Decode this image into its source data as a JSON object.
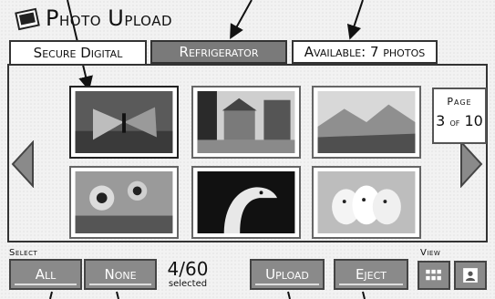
{
  "app": {
    "title_first": "P",
    "title_rest": "hoto",
    "title_first2": "U",
    "title_rest2": "pload"
  },
  "tabs": [
    {
      "label": "Secure Digital"
    },
    {
      "label": "Refrigerator"
    },
    {
      "label": "Available: 7 photos"
    }
  ],
  "photos": [
    {
      "icon": "butterfly-photo"
    },
    {
      "icon": "street-houses-photo"
    },
    {
      "icon": "mountain-landscape-photo"
    },
    {
      "icon": "sunflowers-photo"
    },
    {
      "icon": "bird-photo"
    },
    {
      "icon": "puppies-photo"
    }
  ],
  "page": {
    "label": "Page",
    "current": "3",
    "of": "of",
    "total": "10"
  },
  "select": {
    "label": "Select",
    "all": "All",
    "none": "None"
  },
  "counter": {
    "value": "4/60",
    "sub": "selected"
  },
  "actions": {
    "upload": "Upload",
    "eject": "Eject"
  },
  "view": {
    "label": "View"
  },
  "colors": {
    "tab_active_bg": "#7a7a7a",
    "button_bg": "#8a8a8a"
  }
}
